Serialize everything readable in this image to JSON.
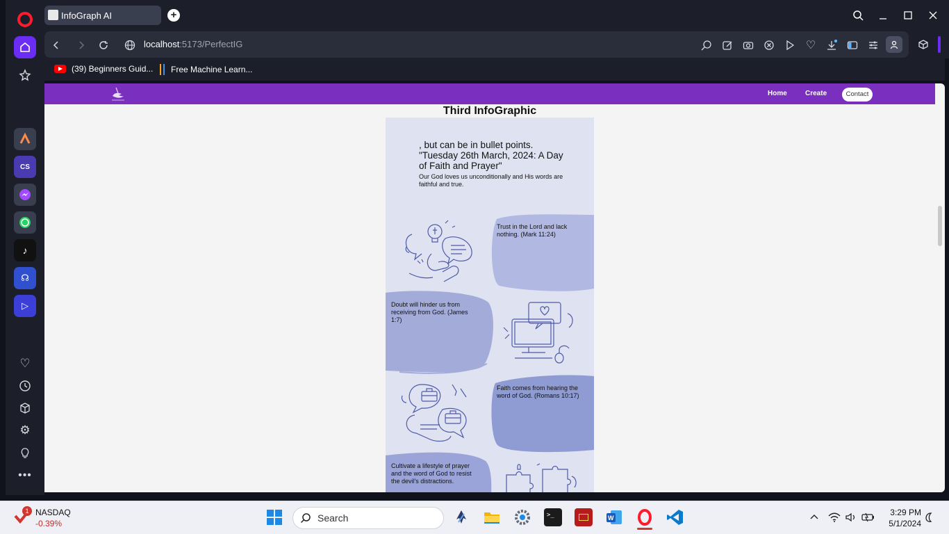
{
  "browser": {
    "tab_title": "InfoGraph AI",
    "url_host": "localhost",
    "url_rest": ":5173/PerfectIG",
    "bookmarks": [
      "(39) Beginners Guid...",
      "Free Machine Learn..."
    ]
  },
  "sidebar": {
    "icons": [
      "opera-logo-icon",
      "home-icon",
      "star-icon",
      "aria-icon",
      "cs-icon",
      "messenger-icon",
      "whatsapp-icon",
      "tiktok-icon",
      "music-icon",
      "player-icon",
      "heart-icon",
      "history-icon",
      "cube-icon",
      "settings-icon",
      "lightbulb-icon",
      "more-icon"
    ]
  },
  "site": {
    "nav": {
      "home": "Home",
      "create": "Create",
      "contact": "Contact"
    },
    "title": "Third InfoGraphic",
    "intro_line1": ", but can be in bullet points.",
    "intro_line2": "\"Tuesday 26th March, 2024: A Day of Faith and Prayer\"",
    "intro_line3": "Our God loves us unconditionally and His words are faithful and true.",
    "points": [
      "Trust in the Lord and lack nothing. (Mark 11:24)",
      "Doubt will hinder us from receiving from God. (James 1:7)",
      "Faith comes from hearing the word of God. (Romans 10:17)",
      "Cultivate a lifestyle of prayer and the word of God to resist the devil's distractions."
    ],
    "colors": {
      "nav": "#7b2fbf",
      "panel": "#dfe2f1",
      "blob1": "#b1b9e2",
      "blob2": "#a3acd9",
      "blob3": "#8f9bd3",
      "blob4": "#9aa4d8"
    }
  },
  "taskbar": {
    "ticker_name": "NASDAQ",
    "ticker_change": "-0.39%",
    "ticker_badge": "1",
    "search_placeholder": "Search",
    "time": "3:29 PM",
    "date": "5/1/2024"
  }
}
